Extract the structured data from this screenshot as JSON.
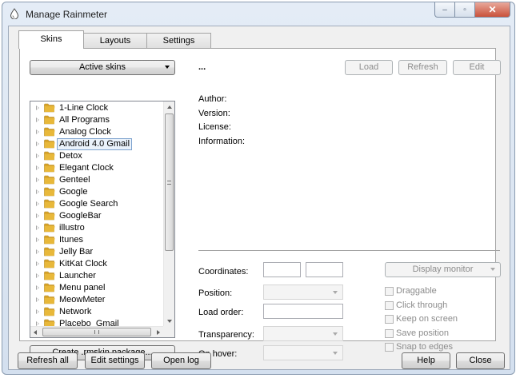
{
  "window": {
    "title": "Manage Rainmeter"
  },
  "tabs": [
    "Skins",
    "Layouts",
    "Settings"
  ],
  "skins": {
    "active_skins_label": "Active skins",
    "skin_name": "...",
    "load_label": "Load",
    "refresh_label": "Refresh",
    "edit_label": "Edit",
    "info": {
      "author_label": "Author:",
      "version_label": "Version:",
      "license_label": "License:",
      "information_label": "Information:"
    },
    "tree": [
      {
        "label": "1-Line Clock",
        "selected": false
      },
      {
        "label": "All Programs",
        "selected": false
      },
      {
        "label": "Analog Clock",
        "selected": false
      },
      {
        "label": "Android 4.0 Gmail",
        "selected": true
      },
      {
        "label": "Detox",
        "selected": false
      },
      {
        "label": "Elegant Clock",
        "selected": false
      },
      {
        "label": "Genteel",
        "selected": false
      },
      {
        "label": "Google",
        "selected": false
      },
      {
        "label": "Google Search",
        "selected": false
      },
      {
        "label": "GoogleBar",
        "selected": false
      },
      {
        "label": "illustro",
        "selected": false
      },
      {
        "label": "Itunes",
        "selected": false
      },
      {
        "label": "Jelly Bar",
        "selected": false
      },
      {
        "label": "KitKat Clock",
        "selected": false
      },
      {
        "label": "Launcher",
        "selected": false
      },
      {
        "label": "Menu panel",
        "selected": false
      },
      {
        "label": "MeowMeter",
        "selected": false
      },
      {
        "label": "Network",
        "selected": false
      },
      {
        "label": "Placebo_Gmail",
        "selected": false
      }
    ],
    "create_package_label": "Create .rmskin package...",
    "settings": {
      "coordinates_label": "Coordinates:",
      "position_label": "Position:",
      "load_order_label": "Load order:",
      "transparency_label": "Transparency:",
      "on_hover_label": "On hover:",
      "display_monitor_label": "Display monitor"
    },
    "checkboxes": [
      {
        "label": "Draggable",
        "checked": false
      },
      {
        "label": "Click through",
        "checked": false
      },
      {
        "label": "Keep on screen",
        "checked": false
      },
      {
        "label": "Save position",
        "checked": false
      },
      {
        "label": "Snap to edges",
        "checked": false
      }
    ]
  },
  "footer": {
    "refresh_all_label": "Refresh all",
    "edit_settings_label": "Edit settings",
    "open_log_label": "Open log",
    "help_label": "Help",
    "close_label": "Close"
  },
  "colors": {
    "folder": "#e8b83a",
    "selection_border": "#7da2ce",
    "close_button": "#c9513a"
  }
}
